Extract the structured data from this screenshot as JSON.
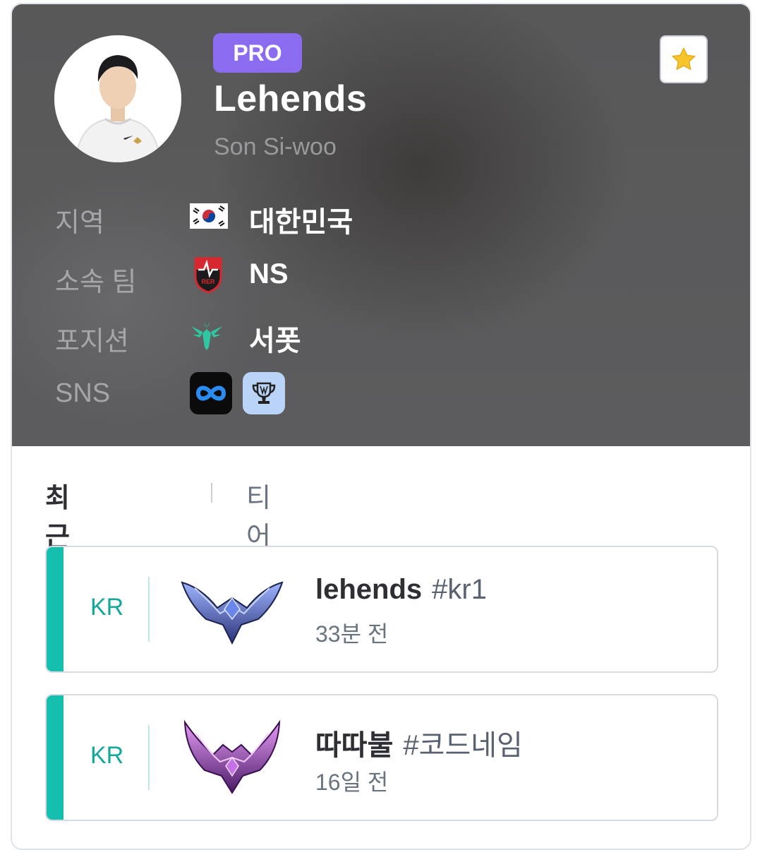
{
  "profile": {
    "badge": "PRO",
    "name": "Lehends",
    "real_name": "Son Si-woo"
  },
  "info": {
    "region_label": "지역",
    "region_value": "대한민국",
    "team_label": "소속 팀",
    "team_value": "NS",
    "position_label": "포지션",
    "position_value": "서폿",
    "sns_label": "SNS"
  },
  "tabs": {
    "recent": "최근 게임순",
    "tier": "티어순"
  },
  "accounts": [
    {
      "region": "KR",
      "name": "lehends",
      "tag": "#kr1",
      "time": "33분 전",
      "tier_icon": "diamond-emblem"
    },
    {
      "region": "KR",
      "name": "따따불",
      "tag": "#코드네임",
      "time": "16일 전",
      "tier_icon": "master-emblem"
    }
  ],
  "colors": {
    "pro_badge": "#8b6cf0",
    "accent": "#14bfae",
    "star": "#f7c52b"
  }
}
